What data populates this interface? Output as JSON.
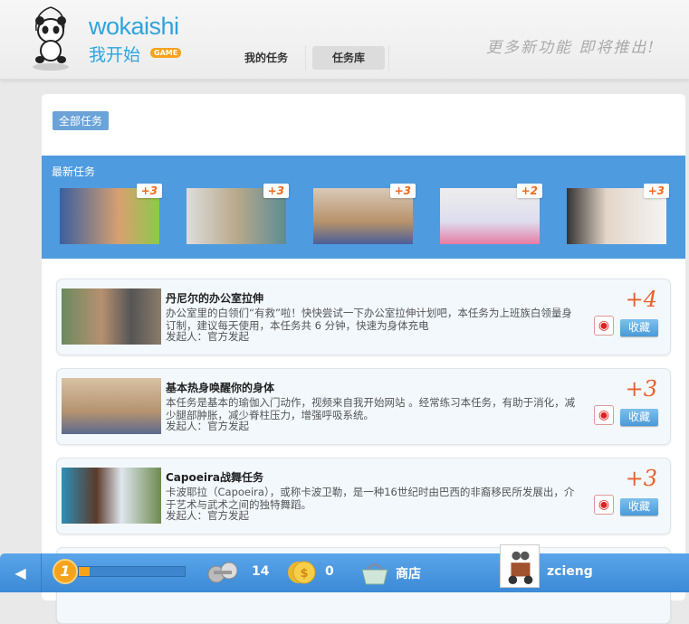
{
  "header": {
    "logo_en": "wokaishi",
    "logo_cn": "我开始",
    "logo_badge": "GAME",
    "nav": [
      {
        "label": "我的任务"
      },
      {
        "label": "任务库",
        "active": true
      }
    ],
    "promo": "更多新功能 即将推出!"
  },
  "filter": {
    "all_label": "全部任务"
  },
  "latest": {
    "title": "最新任务",
    "items": [
      {
        "points": "+3"
      },
      {
        "points": "+3"
      },
      {
        "points": "+3"
      },
      {
        "points": "+2"
      },
      {
        "points": "+3"
      }
    ]
  },
  "tasks": [
    {
      "title": "丹尼尔的办公室拉伸",
      "desc": "办公室里的白领们“有救”啦！快快尝试一下办公室拉伸计划吧，本任务为上班族白领量身订制，建议每天使用，本任务共 6 分钟，快速为身体充电",
      "by": "发起人：官方发起",
      "points": "+4",
      "fav": "收藏"
    },
    {
      "title": "基本热身唤醒你的身体",
      "desc": "本任务是基本的瑜伽入门动作，视频来自我开始网站 。经常练习本任务，有助于消化，减少腿部肿胀，减少脊柱压力，增强呼吸系统。",
      "by": "发起人：官方发起",
      "points": "+3",
      "fav": "收藏"
    },
    {
      "title": "Capoeira战舞任务",
      "desc": "卡波耶拉（Capoeira），或称卡波卫勒，是一种16世纪时由巴西的非裔移民所发展出，介于艺术与武术之间的独特舞蹈。",
      "by": "发起人：官方发起",
      "points": "+3",
      "fav": "收藏"
    }
  ],
  "bottom": {
    "level": "1",
    "xp_progress": 0.1,
    "dumbbells": "14",
    "coins": "0",
    "shop": "商店",
    "username": "zcieng"
  },
  "colors": {
    "accent": "#4f9be0",
    "points": "#e8602c",
    "level": "#f7a21b"
  }
}
